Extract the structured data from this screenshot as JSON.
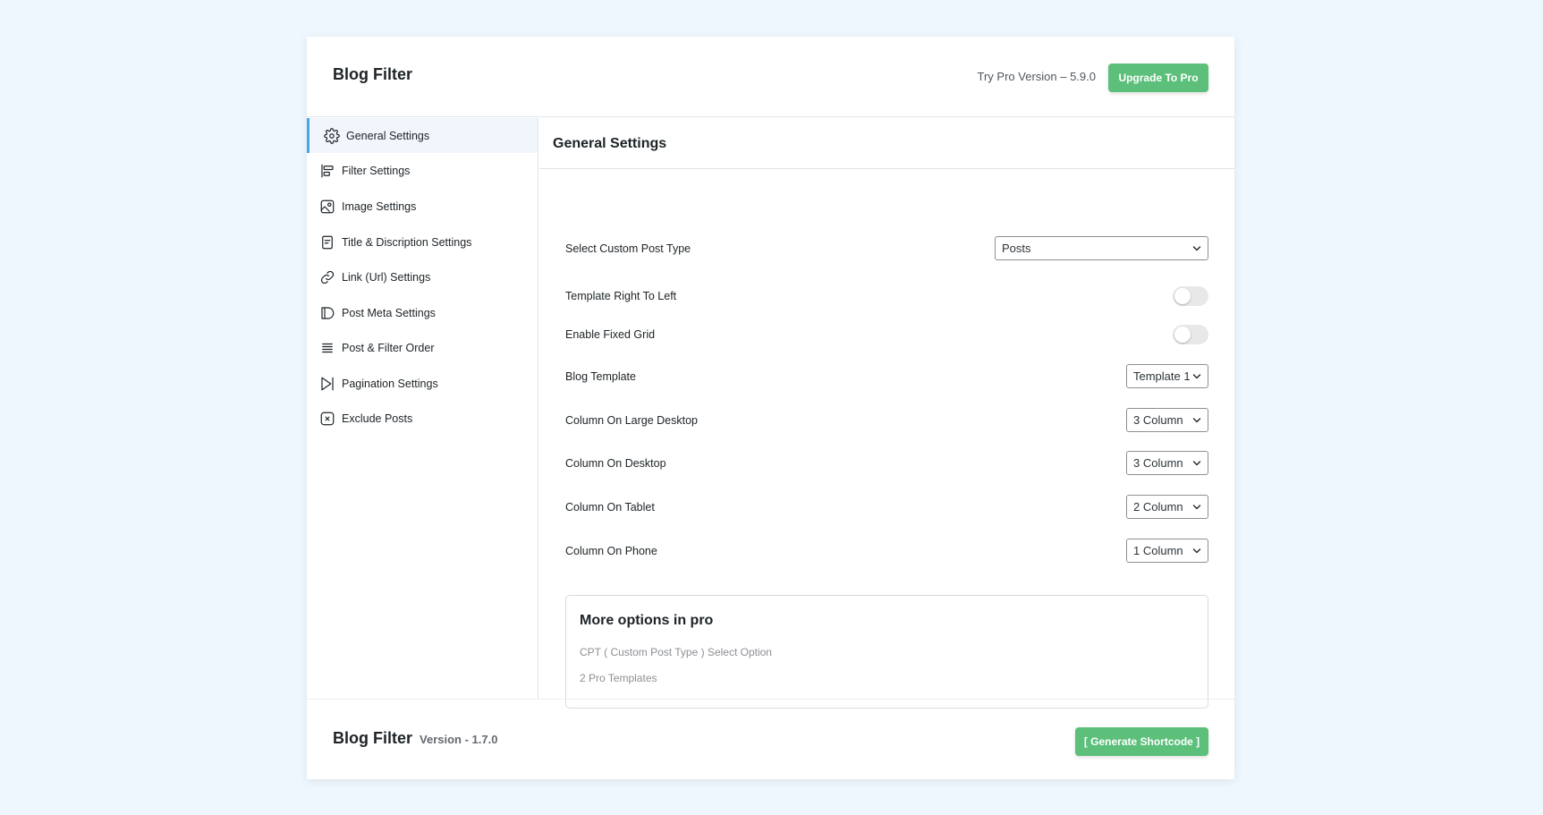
{
  "header": {
    "title": "Blog Filter",
    "pro_text": "Try Pro Version – 5.9.0",
    "upgrade_label": "Upgrade To Pro"
  },
  "sidebar": {
    "items": [
      {
        "label": "General Settings",
        "icon": "gear-icon",
        "active": true
      },
      {
        "label": "Filter Settings",
        "icon": "filter-bars-icon",
        "active": false
      },
      {
        "label": "Image Settings",
        "icon": "image-icon",
        "active": false
      },
      {
        "label": "Title & Discription Settings",
        "icon": "document-icon",
        "active": false
      },
      {
        "label": "Link (Url) Settings",
        "icon": "link-icon",
        "active": false
      },
      {
        "label": "Post Meta Settings",
        "icon": "tag-icon",
        "active": false
      },
      {
        "label": "Post & Filter Order",
        "icon": "list-icon",
        "active": false
      },
      {
        "label": "Pagination Settings",
        "icon": "skip-forward-icon",
        "active": false
      },
      {
        "label": "Exclude Posts",
        "icon": "close-box-icon",
        "active": false
      }
    ]
  },
  "main": {
    "title": "General Settings",
    "settings": {
      "post_type": {
        "label": "Select Custom Post Type",
        "value": "Posts"
      },
      "rtl": {
        "label": "Template Right To Left",
        "enabled": false
      },
      "fixed_grid": {
        "label": "Enable Fixed Grid",
        "enabled": false
      },
      "template": {
        "label": "Blog Template",
        "value": "Template 1"
      },
      "col_large": {
        "label": "Column On Large Desktop",
        "value": "3 Column"
      },
      "col_desktop": {
        "label": "Column On Desktop",
        "value": "3 Column"
      },
      "col_tablet": {
        "label": "Column On Tablet",
        "value": "2 Column"
      },
      "col_phone": {
        "label": "Column On Phone",
        "value": "1 Column"
      }
    },
    "pro_box": {
      "title": "More options in pro",
      "options": [
        "CPT ( Custom Post Type ) Select Option",
        "2 Pro Templates"
      ]
    }
  },
  "footer": {
    "title": "Blog Filter",
    "version": "Version - 1.7.0",
    "generate_label": "[ Generate Shortcode ]"
  },
  "colors": {
    "accent_green": "#5cbf7a",
    "active_border": "#45a7e8",
    "background": "#eef6fe"
  }
}
